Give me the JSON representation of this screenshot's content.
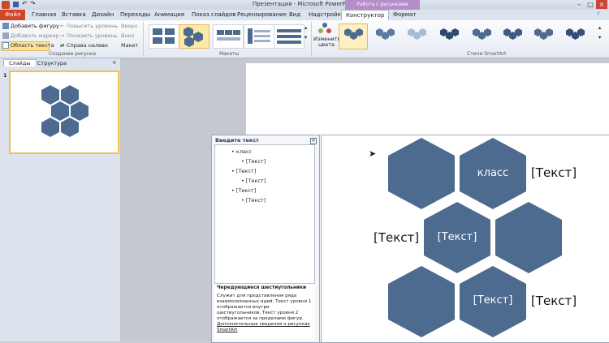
{
  "titlebar": {
    "title": "Презентация - Microsoft PowerPoint",
    "context_tab": "Работа с рисунками SmartArt"
  },
  "tabs": [
    "Файл",
    "Главная",
    "Вставка",
    "Дизайн",
    "Переходы",
    "Анимация",
    "Показ слайдов",
    "Рецензирование",
    "Вид",
    "Надстройки",
    "Конструктор",
    "Формат"
  ],
  "ribbon": {
    "create": {
      "add_shape": "Добавить фигуру",
      "add_bullet": "Добавить маркер",
      "text_pane": "Область текста",
      "promote": "Повысить уровень",
      "demote": "Понизить уровень",
      "rtl": "Справа налево",
      "up": "Вверх",
      "down": "Вниз",
      "layout": "Макет",
      "group_label": "Создание рисунка"
    },
    "layouts_label": "Макеты",
    "change_colors": "Изменить цвета",
    "styles_label": "Стили SmartArt"
  },
  "panes": {
    "slides_tab": "Слайды",
    "outline_tab": "Структура",
    "slide_number": "1"
  },
  "text_pane": {
    "header": "Введите текст",
    "items": [
      {
        "level": 1,
        "text": "класс"
      },
      {
        "level": 2,
        "text": "[Текст]"
      },
      {
        "level": 1,
        "text": "[Текст]"
      },
      {
        "level": 2,
        "text": "[Текст]"
      },
      {
        "level": 1,
        "text": "[Текст]"
      },
      {
        "level": 2,
        "text": "[Текст]"
      }
    ],
    "desc_title": "Чередующиеся шестиугольники",
    "desc_body": "Служит для представления ряда взаимосвязанных идей. Текст уровня 1 отображается внутри шестиугольников. Текст уровня 2 отображается за пределами фигур.",
    "desc_link": "Дополнительные сведения о рисунках SmartArt"
  },
  "smartart": {
    "hex1_text": "класс",
    "hex1_outside": "[Текст]",
    "hex2_text": "[Текст]",
    "hex2_outside": "[Текст]",
    "hex3_text": "[Текст]",
    "hex3_outside": "[Текст]"
  },
  "colors": {
    "hex_fill": "#4d6a8f",
    "file_tab": "#d24726",
    "context_tab": "#b48dc9",
    "selection": "#f2c14c"
  }
}
